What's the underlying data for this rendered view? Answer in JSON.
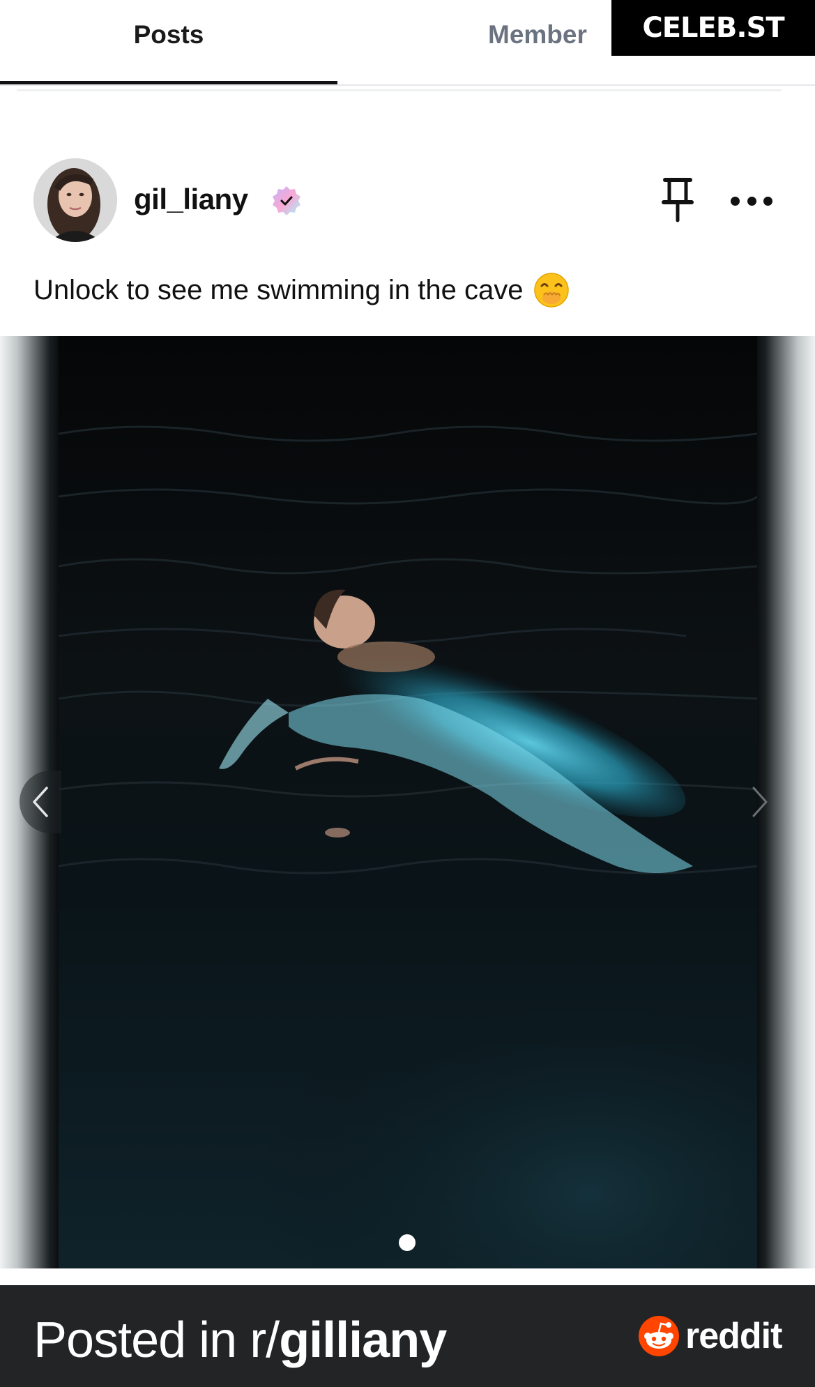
{
  "tabs": [
    {
      "label": "Posts",
      "active": true
    },
    {
      "label": "Member",
      "active": false
    }
  ],
  "watermark": "CELEB.ST",
  "post": {
    "username": "gil_liany",
    "verified": true,
    "caption": "Unlock to see me swimming in the cave",
    "caption_emoji": "face-with-hand-over-mouth",
    "media": {
      "pager_total": 1,
      "pager_current": 1
    }
  },
  "footer": {
    "prefix": "Posted in r/",
    "subreddit": "gilliany",
    "brand": "reddit"
  },
  "colors": {
    "accent_orange": "#ff4500",
    "footer_bg": "#222426",
    "inactive_tab": "#6b7280"
  }
}
